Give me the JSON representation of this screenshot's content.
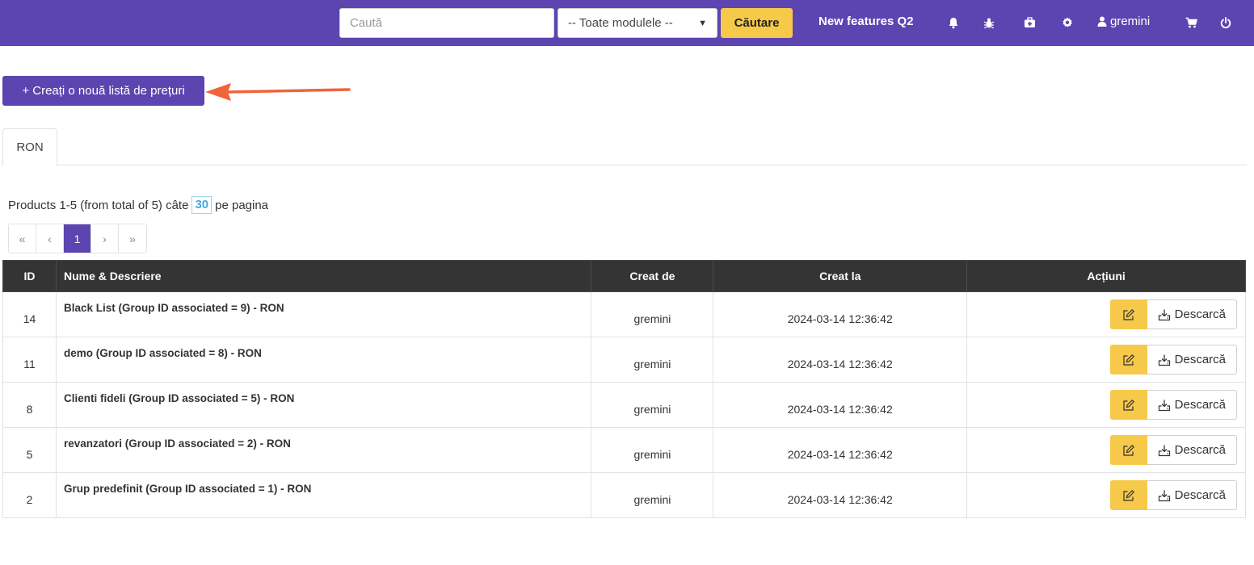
{
  "header": {
    "search_placeholder": "Caută",
    "module_select_value": "-- Toate modulele --",
    "search_button": "Căutare",
    "new_features": "New features Q2",
    "username": "gremini",
    "icons": [
      "bell-icon",
      "bug-icon",
      "medkit-icon",
      "gear-icon",
      "user-icon",
      "cart-icon",
      "power-icon"
    ]
  },
  "create_button": "+ Creați o nouă listă de prețuri",
  "annotation_arrow_color": "#f0643c",
  "tabs": [
    {
      "label": "RON",
      "active": true
    }
  ],
  "pagination": {
    "info_text": "Products 1-5 (from total of 5) câte",
    "per_page": "30",
    "per_page_suffix": "pe pagina",
    "first": "«",
    "prev": "‹",
    "current": "1",
    "next": "›",
    "last": "»"
  },
  "table": {
    "headers": {
      "id": "ID",
      "name": "Nume & Descriere",
      "created_by": "Creat de",
      "created_at": "Creat la",
      "actions": "Acțiuni"
    },
    "download_label": "Descarcă",
    "rows": [
      {
        "id": "14",
        "name": "Black List (Group ID associated = 9) - RON",
        "created_by": "gremini",
        "created_at": "2024-03-14 12:36:42"
      },
      {
        "id": "11",
        "name": "demo (Group ID associated = 8) - RON",
        "created_by": "gremini",
        "created_at": "2024-03-14 12:36:42"
      },
      {
        "id": "8",
        "name": "Clienti fideli (Group ID associated = 5) - RON",
        "created_by": "gremini",
        "created_at": "2024-03-14 12:36:42"
      },
      {
        "id": "5",
        "name": "revanzatori (Group ID associated = 2) - RON",
        "created_by": "gremini",
        "created_at": "2024-03-14 12:36:42"
      },
      {
        "id": "2",
        "name": "Grup predefinit (Group ID associated = 1) - RON",
        "created_by": "gremini",
        "created_at": "2024-03-14 12:36:42"
      }
    ]
  },
  "colors": {
    "brand": "#5c45b0",
    "accent_yellow": "#f6c94a",
    "table_header": "#343434"
  }
}
